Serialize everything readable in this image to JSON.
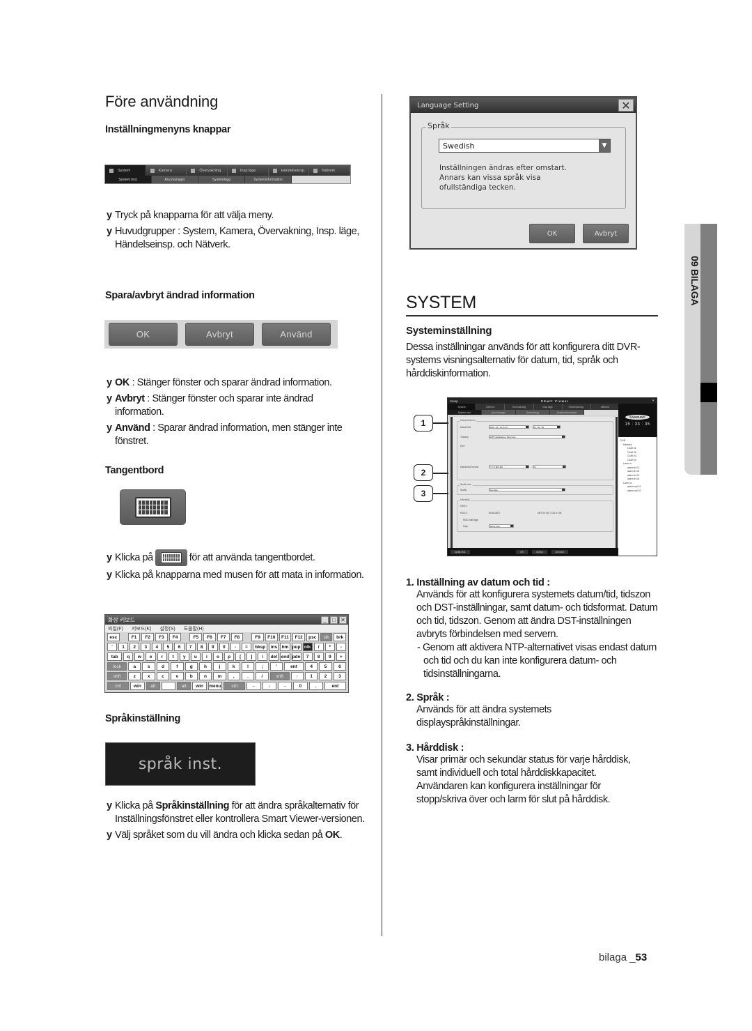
{
  "left": {
    "title": "Före användning",
    "sections": {
      "menu_buttons": {
        "heading": "Inställningmenyns knappar",
        "menubar": {
          "tabs": [
            "System",
            "Kamera",
            "Övervakning",
            "Insp.läge",
            "Händelseinsp.",
            "Nätverk"
          ],
          "subtabs": [
            "System inst.",
            "Anv.manager",
            "Systemlogg",
            "Systeminformation"
          ]
        },
        "bullets": [
          "Tryck på knapparna för att välja meny.",
          "Huvudgrupper : System, Kamera, Övervakning, Insp. läge, Händelseinsp. och Nätverk."
        ]
      },
      "save_cancel": {
        "heading": "Spara/avbryt ändrad information",
        "buttons": [
          "OK",
          "Avbryt",
          "Använd"
        ],
        "bullets": [
          {
            "bold": "OK",
            "text": " : Stänger fönster och sparar ändrad information."
          },
          {
            "bold": "Avbryt",
            "text": " : Stänger fönster och sparar inte ändrad information."
          },
          {
            "bold": "Använd",
            "text": " : Sparar ändrad information, men stänger inte fönstret."
          }
        ]
      },
      "keyboard": {
        "heading": "Tangentbord",
        "bullet1_before": "Klicka på",
        "bullet1_after": "för att använda tangentbordet.",
        "bullet2": "Klicka på knapparna med musen för att mata in information.",
        "vk": {
          "title": "화상 키보드",
          "menu": [
            "파일(F)",
            "키보드(K)",
            "설정(S)",
            "도움말(H)"
          ],
          "rows": [
            [
              "esc",
              "",
              "F1",
              "F2",
              "F3",
              "F4",
              "",
              "F5",
              "F6",
              "F7",
              "F8",
              "",
              "F9",
              "F10",
              "F11",
              "F12",
              "psc",
              "slk",
              "brk"
            ],
            [
              "`",
              "1",
              "2",
              "3",
              "4",
              "5",
              "6",
              "7",
              "8",
              "9",
              "0",
              "-",
              "=",
              "bksp",
              "ins",
              "hm",
              "pup",
              "nlk",
              "/",
              "*",
              "-"
            ],
            [
              "tab",
              "q",
              "w",
              "e",
              "r",
              "t",
              "y",
              "u",
              "i",
              "o",
              "p",
              "[",
              "]",
              "\\",
              "del",
              "end",
              "pdn",
              "7",
              "8",
              "9",
              "+"
            ],
            [
              "lock",
              "a",
              "s",
              "d",
              "f",
              "g",
              "h",
              "j",
              "k",
              "l",
              ";",
              "'",
              "ent",
              "4",
              "5",
              "6"
            ],
            [
              "shft",
              "z",
              "x",
              "c",
              "v",
              "b",
              "n",
              "m",
              ",",
              ".",
              "/",
              "shft",
              "↑",
              "1",
              "2",
              "3"
            ],
            [
              "ctrl",
              "win",
              "alt",
              "",
              "alt",
              "win",
              "menu",
              "ctrl",
              "←",
              "↓",
              "→",
              "0",
              ".",
              "ent"
            ]
          ]
        }
      },
      "language": {
        "heading": "Språkinställning",
        "button_label": "språk inst.",
        "bullet1": {
          "before": "Klicka på ",
          "bold": "Språkinställning",
          "after": " för att ändra språkalternativ för Inställningsfönstret eller kontrollera Smart Viewer-versionen."
        },
        "bullet2": {
          "before": "Välj språket som du vill ändra och klicka sedan på ",
          "bold": "OK",
          "after": "."
        }
      }
    }
  },
  "dialog": {
    "title": "Language Setting",
    "group_label": "Språk",
    "selected_language": "Swedish",
    "note": [
      "Inställningen ändras efter omstart.",
      "Annars kan vissa språk visa",
      "ofullständiga tecken."
    ],
    "ok_label": "OK",
    "cancel_label": "Avbryt"
  },
  "right": {
    "title": "SYSTEM",
    "subtitle": "Systeminställning",
    "intro": "Dessa inställningar används för att konfigurera ditt DVR-systems visningsalternativ för datum, tid, språk och hårddiskinformation.",
    "smart_viewer": {
      "title_left": "Setup",
      "title_center": "Smart Viewer",
      "tabs": [
        "System",
        "Kamera",
        "Övervakning",
        "Insp.läge",
        "Händelseinsp.",
        "Nätverk"
      ],
      "subtabs": [
        "System inst.",
        "Anv.manager",
        "Systemlogg",
        "Systeminformation"
      ],
      "groups": [
        "Datum/tid/zon",
        "Språk inst.",
        "Hårddisk"
      ],
      "labels": [
        "Datum/tid",
        "Tidszon",
        "DST",
        "Datum/tid format",
        "Språk",
        "HDD 1",
        "HDD 2",
        "HDD-fullt läge",
        "Insp."
      ],
      "values": {
        "date": "2000 - 01 - 01 (Lör)",
        "time": "00 : 00 : 00",
        "timezone": "GMT Casablanca, Monrovia",
        "format": "YYYY-MM-DD",
        "hour": "24",
        "language": "Svenska",
        "hdd2_info": "SEAGATE",
        "hdd2_size": "MFS.B GB / 232.9 GB",
        "hdd_mode": "Skriva över"
      },
      "side": {
        "brand": "SAMSUNG",
        "clock": "15 : 33 : 35"
      },
      "tree": [
        "DVR",
        "Kamera",
        "CAM 01",
        "CAM 02",
        "CAM 03",
        "CAM 04",
        "Larm in",
        "alarm in 01",
        "alarm in 02",
        "alarm in 03",
        "alarm in 04",
        "Larm ut",
        "alarm out 01",
        "alarm out 02"
      ],
      "bottom": [
        "språk inst.",
        "OK",
        "Avbryt",
        "Använd"
      ]
    },
    "callouts": [
      "1",
      "2",
      "3"
    ],
    "items": [
      {
        "heading": "1. Inställning av datum och tid :",
        "text": "Används för att konfigurera systemets datum/tid, tidszon och DST-inställningar, samt datum- och tidsformat. Datum och tid, tidszon. Genom att ändra DST-inställningen avbryts förbindelsen med servern.",
        "note": "- Genom att aktivera NTP-alternativet visas endast datum och tid och du kan inte konfigurera datum- och tidsinställningarna."
      },
      {
        "heading": "2. Språk :",
        "text": "Används för att ändra systemets displayspråkinställningar."
      },
      {
        "heading": "3. Hårddisk :",
        "text": "Visar primär och sekundär status för varje hårddisk, samt individuell och total hårddiskkapacitet. Användaren kan konfigurera inställningar för stopp/skriva över och larm för slut på hårddisk."
      }
    ]
  },
  "side_tab": "09 BILAGA",
  "footer": {
    "section": "bilaga _",
    "page": "53"
  },
  "bullet_glyph": "y"
}
